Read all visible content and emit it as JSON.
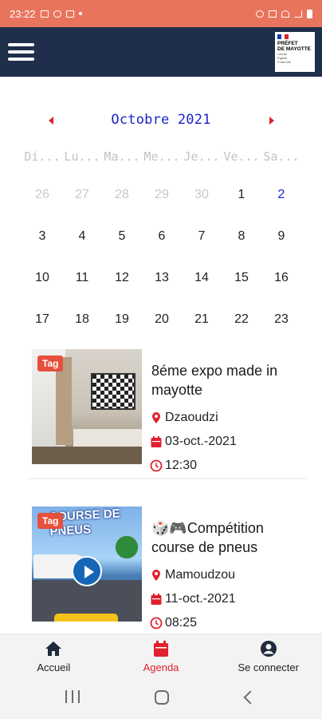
{
  "status_bar": {
    "time": "23:22"
  },
  "header": {
    "logo_line1": "PRÉFET",
    "logo_line2": "DE MAYOTTE",
    "logo_motto1": "Liberté",
    "logo_motto2": "Égalité",
    "logo_motto3": "Fraternité"
  },
  "calendar": {
    "month_label": "Octobre 2021",
    "weekdays": [
      "Di...",
      "Lu...",
      "Ma...",
      "Me...",
      "Je...",
      "Ve...",
      "Sa..."
    ],
    "days": [
      {
        "label": "26",
        "muted": true
      },
      {
        "label": "27",
        "muted": true
      },
      {
        "label": "28",
        "muted": true
      },
      {
        "label": "29",
        "muted": true
      },
      {
        "label": "30",
        "muted": true
      },
      {
        "label": "1",
        "muted": false
      },
      {
        "label": "2",
        "muted": false,
        "accent": true
      },
      {
        "label": "3"
      },
      {
        "label": "4"
      },
      {
        "label": "5"
      },
      {
        "label": "6"
      },
      {
        "label": "7"
      },
      {
        "label": "8"
      },
      {
        "label": "9"
      },
      {
        "label": "10"
      },
      {
        "label": "11"
      },
      {
        "label": "12"
      },
      {
        "label": "13"
      },
      {
        "label": "14"
      },
      {
        "label": "15"
      },
      {
        "label": "16"
      },
      {
        "label": "17"
      },
      {
        "label": "18"
      },
      {
        "label": "19"
      },
      {
        "label": "20"
      },
      {
        "label": "21"
      },
      {
        "label": "22"
      },
      {
        "label": "23"
      }
    ]
  },
  "events": [
    {
      "tag": "Tag",
      "title": "8éme expo made in mayotte",
      "location": "Dzaoudzi",
      "date": "03-oct.-2021",
      "time": "12:30"
    },
    {
      "tag": "Tag",
      "title": "🎲🎮Compétition course de pneus",
      "location": "Mamoudzou",
      "date": "11-oct.-2021",
      "time": "08:25",
      "poster_text": "COURSE DE PNEUS"
    }
  ],
  "bottom_nav": [
    {
      "label": "Accueil",
      "icon": "home-icon",
      "active": false
    },
    {
      "label": "Agenda",
      "icon": "calendar-icon",
      "active": true
    },
    {
      "label": "Se connecter",
      "icon": "account-icon",
      "active": false
    }
  ],
  "colors": {
    "status_bar": "#e8745d",
    "app_bar": "#1f2e4a",
    "accent_red": "#e0202e",
    "calendar_blue": "#1a23c9"
  }
}
